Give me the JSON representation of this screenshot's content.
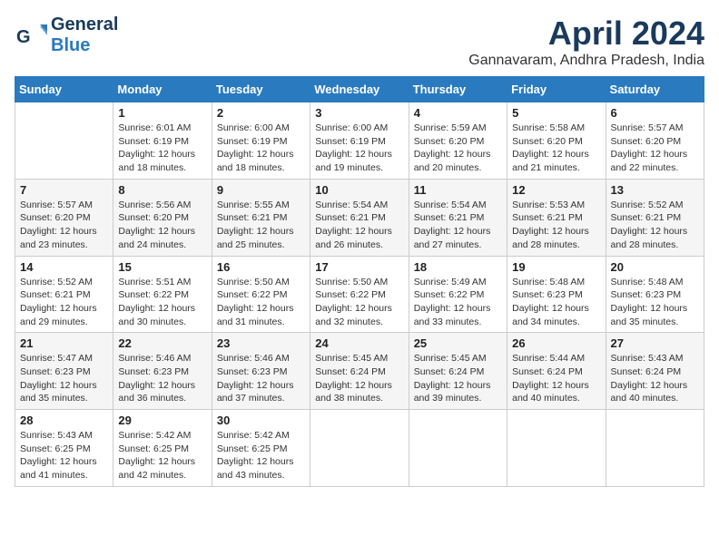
{
  "header": {
    "logo_line1": "General",
    "logo_line2": "Blue",
    "month_title": "April 2024",
    "location": "Gannavaram, Andhra Pradesh, India"
  },
  "days_of_week": [
    "Sunday",
    "Monday",
    "Tuesday",
    "Wednesday",
    "Thursday",
    "Friday",
    "Saturday"
  ],
  "weeks": [
    [
      {
        "num": "",
        "info": ""
      },
      {
        "num": "1",
        "info": "Sunrise: 6:01 AM\nSunset: 6:19 PM\nDaylight: 12 hours\nand 18 minutes."
      },
      {
        "num": "2",
        "info": "Sunrise: 6:00 AM\nSunset: 6:19 PM\nDaylight: 12 hours\nand 18 minutes."
      },
      {
        "num": "3",
        "info": "Sunrise: 6:00 AM\nSunset: 6:19 PM\nDaylight: 12 hours\nand 19 minutes."
      },
      {
        "num": "4",
        "info": "Sunrise: 5:59 AM\nSunset: 6:20 PM\nDaylight: 12 hours\nand 20 minutes."
      },
      {
        "num": "5",
        "info": "Sunrise: 5:58 AM\nSunset: 6:20 PM\nDaylight: 12 hours\nand 21 minutes."
      },
      {
        "num": "6",
        "info": "Sunrise: 5:57 AM\nSunset: 6:20 PM\nDaylight: 12 hours\nand 22 minutes."
      }
    ],
    [
      {
        "num": "7",
        "info": "Sunrise: 5:57 AM\nSunset: 6:20 PM\nDaylight: 12 hours\nand 23 minutes."
      },
      {
        "num": "8",
        "info": "Sunrise: 5:56 AM\nSunset: 6:20 PM\nDaylight: 12 hours\nand 24 minutes."
      },
      {
        "num": "9",
        "info": "Sunrise: 5:55 AM\nSunset: 6:21 PM\nDaylight: 12 hours\nand 25 minutes."
      },
      {
        "num": "10",
        "info": "Sunrise: 5:54 AM\nSunset: 6:21 PM\nDaylight: 12 hours\nand 26 minutes."
      },
      {
        "num": "11",
        "info": "Sunrise: 5:54 AM\nSunset: 6:21 PM\nDaylight: 12 hours\nand 27 minutes."
      },
      {
        "num": "12",
        "info": "Sunrise: 5:53 AM\nSunset: 6:21 PM\nDaylight: 12 hours\nand 28 minutes."
      },
      {
        "num": "13",
        "info": "Sunrise: 5:52 AM\nSunset: 6:21 PM\nDaylight: 12 hours\nand 28 minutes."
      }
    ],
    [
      {
        "num": "14",
        "info": "Sunrise: 5:52 AM\nSunset: 6:21 PM\nDaylight: 12 hours\nand 29 minutes."
      },
      {
        "num": "15",
        "info": "Sunrise: 5:51 AM\nSunset: 6:22 PM\nDaylight: 12 hours\nand 30 minutes."
      },
      {
        "num": "16",
        "info": "Sunrise: 5:50 AM\nSunset: 6:22 PM\nDaylight: 12 hours\nand 31 minutes."
      },
      {
        "num": "17",
        "info": "Sunrise: 5:50 AM\nSunset: 6:22 PM\nDaylight: 12 hours\nand 32 minutes."
      },
      {
        "num": "18",
        "info": "Sunrise: 5:49 AM\nSunset: 6:22 PM\nDaylight: 12 hours\nand 33 minutes."
      },
      {
        "num": "19",
        "info": "Sunrise: 5:48 AM\nSunset: 6:23 PM\nDaylight: 12 hours\nand 34 minutes."
      },
      {
        "num": "20",
        "info": "Sunrise: 5:48 AM\nSunset: 6:23 PM\nDaylight: 12 hours\nand 35 minutes."
      }
    ],
    [
      {
        "num": "21",
        "info": "Sunrise: 5:47 AM\nSunset: 6:23 PM\nDaylight: 12 hours\nand 35 minutes."
      },
      {
        "num": "22",
        "info": "Sunrise: 5:46 AM\nSunset: 6:23 PM\nDaylight: 12 hours\nand 36 minutes."
      },
      {
        "num": "23",
        "info": "Sunrise: 5:46 AM\nSunset: 6:23 PM\nDaylight: 12 hours\nand 37 minutes."
      },
      {
        "num": "24",
        "info": "Sunrise: 5:45 AM\nSunset: 6:24 PM\nDaylight: 12 hours\nand 38 minutes."
      },
      {
        "num": "25",
        "info": "Sunrise: 5:45 AM\nSunset: 6:24 PM\nDaylight: 12 hours\nand 39 minutes."
      },
      {
        "num": "26",
        "info": "Sunrise: 5:44 AM\nSunset: 6:24 PM\nDaylight: 12 hours\nand 40 minutes."
      },
      {
        "num": "27",
        "info": "Sunrise: 5:43 AM\nSunset: 6:24 PM\nDaylight: 12 hours\nand 40 minutes."
      }
    ],
    [
      {
        "num": "28",
        "info": "Sunrise: 5:43 AM\nSunset: 6:25 PM\nDaylight: 12 hours\nand 41 minutes."
      },
      {
        "num": "29",
        "info": "Sunrise: 5:42 AM\nSunset: 6:25 PM\nDaylight: 12 hours\nand 42 minutes."
      },
      {
        "num": "30",
        "info": "Sunrise: 5:42 AM\nSunset: 6:25 PM\nDaylight: 12 hours\nand 43 minutes."
      },
      {
        "num": "",
        "info": ""
      },
      {
        "num": "",
        "info": ""
      },
      {
        "num": "",
        "info": ""
      },
      {
        "num": "",
        "info": ""
      }
    ]
  ]
}
